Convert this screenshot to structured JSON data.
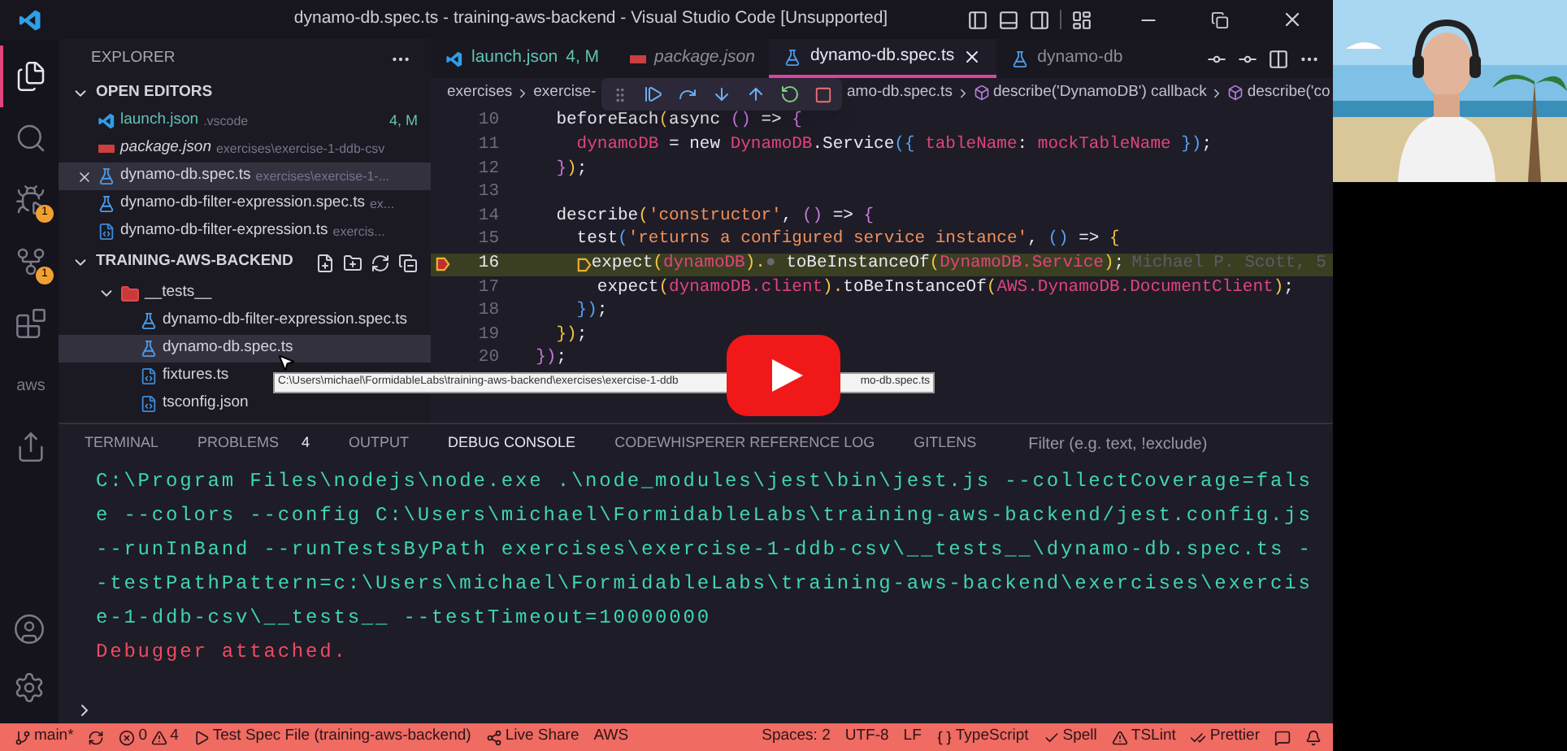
{
  "window": {
    "title": "dynamo-db.spec.ts - training-aws-backend - Visual Studio Code [Unsupported]"
  },
  "activity_bar": {
    "items": [
      {
        "kind": "files",
        "selected": true
      },
      {
        "kind": "search",
        "selected": false
      },
      {
        "kind": "debug",
        "selected": false,
        "badge": "1"
      },
      {
        "kind": "source-control",
        "selected": false,
        "badge": "1"
      },
      {
        "kind": "extensions",
        "selected": false
      },
      {
        "kind": "aws",
        "selected": false,
        "label": "aws"
      },
      {
        "kind": "remote",
        "selected": false
      }
    ],
    "bottom": [
      {
        "kind": "account"
      },
      {
        "kind": "settings"
      }
    ]
  },
  "sidebar": {
    "title": "EXPLORER",
    "open_editors": {
      "title": "OPEN EDITORS",
      "expanded": true,
      "items": [
        {
          "name": "launch.json",
          "kind": "vscode",
          "description": ".vscode",
          "badge": "4, M",
          "preview": false,
          "selected": false
        },
        {
          "name": "package.json",
          "kind": "npm",
          "description": "exercises\\exercise-1-ddb-csv",
          "preview": true,
          "selected": false
        },
        {
          "name": "dynamo-db.spec.ts",
          "kind": "test",
          "description": "exercises\\exercise-1-...",
          "preview": false,
          "selected": true
        },
        {
          "name": "dynamo-db-filter-expression.spec.ts",
          "kind": "test",
          "description": "ex...",
          "preview": false,
          "selected": false
        },
        {
          "name": "dynamo-db-filter-expression.ts",
          "kind": "ts",
          "description": "exercis...",
          "preview": false,
          "selected": false
        }
      ]
    },
    "project": {
      "title": "TRAINING-AWS-BACKEND",
      "expanded": true,
      "tree": [
        {
          "name": "__tests__",
          "kind": "folder",
          "expanded": true,
          "selected": false,
          "children": [
            {
              "name": "dynamo-db-filter-expression.spec.ts",
              "kind": "test",
              "selected": false
            },
            {
              "name": "dynamo-db.spec.ts",
              "kind": "test",
              "selected": true
            },
            {
              "name": "fixtures.ts",
              "kind": "ts",
              "selected": false
            },
            {
              "name": "tsconfig.json",
              "kind": "ts",
              "selected": false
            }
          ]
        }
      ]
    }
  },
  "tooltip": {
    "parts": [
      "C:\\Users\\michael\\FormidableLabs\\training-aws-backend\\exercises\\exercise-1-ddb",
      "mo-db.spec.ts"
    ]
  },
  "editor": {
    "tabs": [
      {
        "name": "launch.json",
        "kind": "vscode",
        "badge": "4, M",
        "preview": false,
        "selected": false
      },
      {
        "name": "package.json",
        "kind": "npm",
        "preview": true,
        "selected": false
      },
      {
        "name": "dynamo-db.spec.ts",
        "kind": "test",
        "preview": false,
        "selected": true
      },
      {
        "name": "dynamo-db",
        "kind": "test",
        "preview": false,
        "selected": false
      }
    ],
    "breadcrumbs": {
      "left": [
        {
          "text": "exercises",
          "symbol": false
        },
        {
          "text": "exercise-",
          "symbol": false
        }
      ],
      "right": [
        {
          "text": "amo-db.spec.ts",
          "symbol": false
        },
        {
          "text": "describe('DynamoDB') callback",
          "symbol": true
        },
        {
          "text": "describe('co",
          "symbol": true
        }
      ]
    },
    "lines": [
      {
        "number": "10",
        "highlighted": false,
        "breakpoint": false,
        "tokens": [
          {
            "text": "    beforeEach",
            "kind": "plain"
          },
          {
            "text": "(",
            "kind": "yellow"
          },
          {
            "text": "async ",
            "kind": "plain"
          },
          {
            "text": "()",
            "kind": "purple"
          },
          {
            "text": " => ",
            "kind": "plain"
          },
          {
            "text": "{",
            "kind": "purple"
          }
        ]
      },
      {
        "number": "11",
        "highlighted": false,
        "breakpoint": false,
        "tokens": [
          {
            "text": "      dynamoDB",
            "kind": "variable"
          },
          {
            "text": " = new ",
            "kind": "plain"
          },
          {
            "text": "DynamoDB",
            "kind": "variable"
          },
          {
            "text": ".Service",
            "kind": "plain"
          },
          {
            "text": "({ ",
            "kind": "blue"
          },
          {
            "text": "tableName",
            "kind": "variable"
          },
          {
            "text": ": ",
            "kind": "plain"
          },
          {
            "text": "mockTableName",
            "kind": "variable"
          },
          {
            "text": " })",
            "kind": "blue"
          },
          {
            "text": ";",
            "kind": "plain"
          }
        ]
      },
      {
        "number": "12",
        "highlighted": false,
        "breakpoint": false,
        "tokens": [
          {
            "text": "    }",
            "kind": "purple"
          },
          {
            "text": ")",
            "kind": "yellow"
          },
          {
            "text": ";",
            "kind": "plain"
          }
        ]
      },
      {
        "number": "13",
        "highlighted": false,
        "breakpoint": false
      },
      {
        "number": "14",
        "highlighted": false,
        "breakpoint": false,
        "tokens": [
          {
            "text": "    describe",
            "kind": "plain"
          },
          {
            "text": "(",
            "kind": "yellow"
          },
          {
            "text": "'constructor'",
            "kind": "string"
          },
          {
            "text": ", ",
            "kind": "plain"
          },
          {
            "text": "()",
            "kind": "purple"
          },
          {
            "text": " => ",
            "kind": "plain"
          },
          {
            "text": "{",
            "kind": "purple"
          }
        ]
      },
      {
        "number": "15",
        "highlighted": false,
        "breakpoint": false,
        "tokens": [
          {
            "text": "      test",
            "kind": "plain"
          },
          {
            "text": "(",
            "kind": "blue"
          },
          {
            "text": "'returns a configured service instance'",
            "kind": "string"
          },
          {
            "text": ", ",
            "kind": "plain"
          },
          {
            "text": "()",
            "kind": "blue"
          },
          {
            "text": " => ",
            "kind": "plain"
          },
          {
            "text": "{",
            "kind": "yellow"
          }
        ]
      },
      {
        "number": "16",
        "highlighted": true,
        "breakpoint": true,
        "blame": "Michael P. Scott, 5",
        "tokens": [
          {
            "text": "expect",
            "kind": "plain"
          },
          {
            "text": "(",
            "kind": "yellow"
          },
          {
            "text": "dynamoDB",
            "kind": "variable"
          },
          {
            "text": ").",
            "kind": "yellow"
          },
          {
            "text": "● ",
            "kind": "muted"
          },
          {
            "text": "toBeInstanceOf",
            "kind": "plain"
          },
          {
            "text": "(",
            "kind": "yellow"
          },
          {
            "text": "DynamoDB.Service",
            "kind": "variable"
          },
          {
            "text": ")",
            "kind": "yellow"
          },
          {
            "text": ";",
            "kind": "plain"
          }
        ]
      },
      {
        "number": "17",
        "highlighted": false,
        "breakpoint": false,
        "tokens": [
          {
            "text": "        expect",
            "kind": "plain"
          },
          {
            "text": "(",
            "kind": "yellow"
          },
          {
            "text": "dynamoDB.client",
            "kind": "variable"
          },
          {
            "text": ").",
            "kind": "yellow"
          },
          {
            "text": "toBeInstanceOf",
            "kind": "plain"
          },
          {
            "text": "(",
            "kind": "yellow"
          },
          {
            "text": "AWS.DynamoDB.DocumentClient",
            "kind": "variable"
          },
          {
            "text": ")",
            "kind": "yellow"
          },
          {
            "text": ";",
            "kind": "plain"
          }
        ]
      },
      {
        "number": "18",
        "highlighted": false,
        "breakpoint": false,
        "tokens": [
          {
            "text": "      })",
            "kind": "blue"
          },
          {
            "text": ";",
            "kind": "plain"
          }
        ]
      },
      {
        "number": "19",
        "highlighted": false,
        "breakpoint": false,
        "tokens": [
          {
            "text": "    })",
            "kind": "yellow"
          },
          {
            "text": ";",
            "kind": "plain"
          }
        ]
      },
      {
        "number": "20",
        "highlighted": false,
        "breakpoint": false,
        "tokens": [
          {
            "text": "  })",
            "kind": "purple"
          },
          {
            "text": ";",
            "kind": "plain"
          }
        ]
      }
    ]
  },
  "panel": {
    "tabs": [
      {
        "label": "TERMINAL",
        "selected": false
      },
      {
        "label": "PROBLEMS",
        "badge": "4",
        "selected": false
      },
      {
        "label": "OUTPUT",
        "selected": false
      },
      {
        "label": "DEBUG CONSOLE",
        "selected": true
      },
      {
        "label": "CODEWHISPERER REFERENCE LOG",
        "selected": false
      },
      {
        "label": "GITLENS",
        "selected": false
      }
    ],
    "filter": {
      "placeholder": "Filter (e.g. text, !exclude)"
    },
    "console": [
      {
        "kind": "command",
        "text": "C:\\Program Files\\nodejs\\node.exe .\\node_modules\\jest\\bin\\jest.js --collectCoverage=false --colors --config C:\\Users\\michael\\FormidableLabs\\training-aws-backend/jest.config.js --runInBand --runTestsByPath exercises\\exercise-1-ddb-csv\\__tests__\\dynamo-db.spec.ts --testPathPattern=c:\\Users\\michael\\FormidableLabs\\training-aws-backend\\exercises\\exercise-1-ddb-csv\\__tests__ --testTimeout=10000000"
      },
      {
        "kind": "error",
        "text": "Debugger attached."
      }
    ]
  },
  "status_bar": {
    "left": [
      {
        "kind": "branch",
        "text": "main*"
      },
      {
        "kind": "sync"
      },
      {
        "kind": "problems",
        "errors": "0",
        "warnings": "4"
      },
      {
        "kind": "test",
        "text": "Test Spec File (training-aws-backend)"
      },
      {
        "kind": "liveshare",
        "text": "Live Share"
      },
      {
        "kind": "plain",
        "text": "AWS"
      }
    ],
    "right": [
      {
        "kind": "plain",
        "text": "Spaces: 2"
      },
      {
        "kind": "plain",
        "text": "UTF-8"
      },
      {
        "kind": "plain",
        "text": "LF"
      },
      {
        "kind": "braces",
        "text": "TypeScript"
      },
      {
        "kind": "check",
        "text": "Spell"
      },
      {
        "kind": "warning",
        "text": "TSLint"
      },
      {
        "kind": "checks",
        "text": "Prettier"
      },
      {
        "kind": "feedback"
      },
      {
        "kind": "bell"
      }
    ]
  }
}
